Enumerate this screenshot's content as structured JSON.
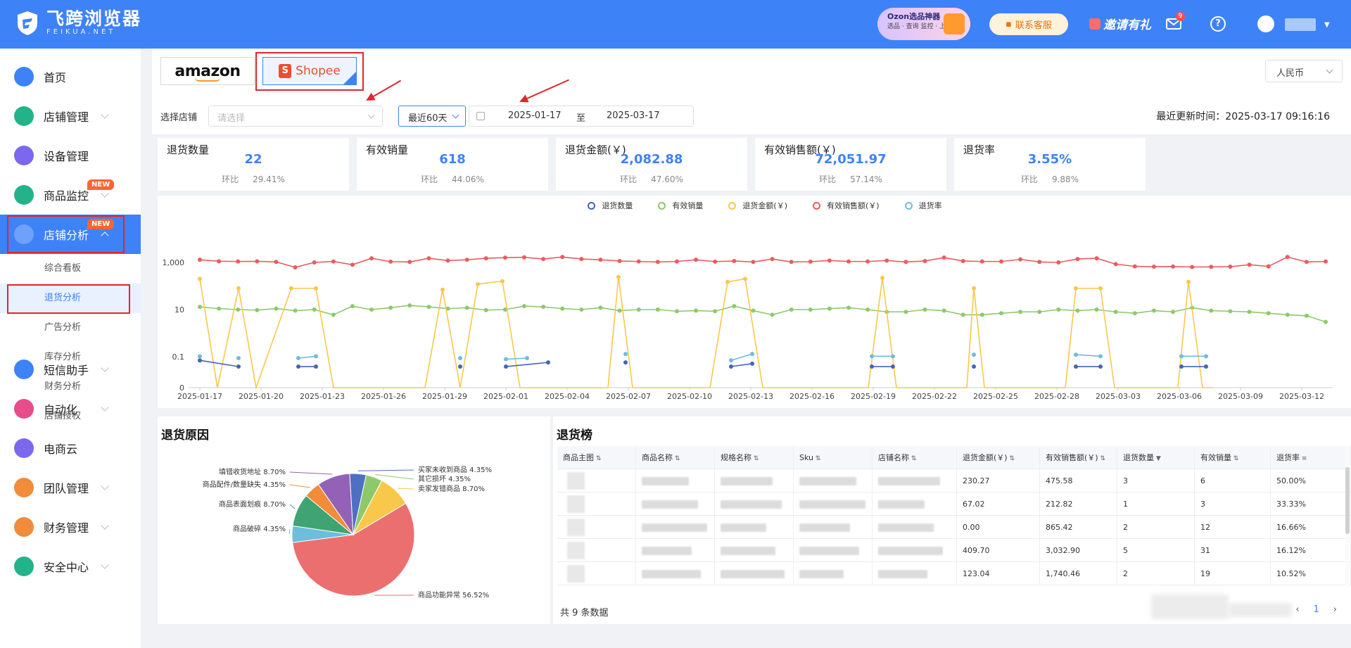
{
  "header": {
    "logo_cn": "飞跨浏览器",
    "logo_en": "FEIKUA.NET",
    "ozon_title": "Ozon选品神器",
    "ozon_sub": "选品 · 查询 监控 · 上货",
    "service": "联系客服",
    "invite": "邀请有礼",
    "mail_count": "9",
    "help": "?"
  },
  "sidebar": {
    "items": [
      {
        "label": "首页",
        "icon": "home-icon",
        "color": "#3e82f7"
      },
      {
        "label": "店铺管理",
        "icon": "store-icon",
        "color": "#22b38a"
      },
      {
        "label": "设备管理",
        "icon": "device-icon",
        "color": "#7b68ee"
      },
      {
        "label": "商品监控",
        "icon": "monitor-icon",
        "color": "#22b38a",
        "badge": "NEW"
      },
      {
        "label": "店铺分析",
        "icon": "analysis-icon",
        "color": "#ffffff",
        "badge": "NEW"
      },
      {
        "label": "短信助手",
        "icon": "sms-icon",
        "color": "#3e82f7"
      },
      {
        "label": "自动化",
        "icon": "robot-icon",
        "color": "#e84c8a"
      },
      {
        "label": "电商云",
        "icon": "cloud-icon",
        "color": "#7b68ee"
      },
      {
        "label": "团队管理",
        "icon": "team-icon",
        "color": "#f08c3a"
      },
      {
        "label": "财务管理",
        "icon": "wallet-icon",
        "color": "#f08c3a"
      },
      {
        "label": "安全中心",
        "icon": "shield-icon",
        "color": "#22b38a"
      }
    ],
    "subitems": [
      "综合看板",
      "退货分析",
      "广告分析",
      "库存分析",
      "财务分析",
      "店铺授权"
    ]
  },
  "platforms": {
    "amazon": "amazon",
    "shopee": "Shopee"
  },
  "currency": "人民币",
  "filters": {
    "shop_label": "选择店铺",
    "shop_placeholder": "请选择",
    "range": "最近60天",
    "start": "2025-01-17",
    "to": "至",
    "end": "2025-03-17",
    "updated": "最近更新时间：2025-03-17 09:16:16"
  },
  "kpis": [
    {
      "title": "退货数量",
      "value": "22",
      "cmp_label": "环比",
      "cmp": "29.41%"
    },
    {
      "title": "有效销量",
      "value": "618",
      "cmp_label": "环比",
      "cmp": "44.06%"
    },
    {
      "title": "退货金额(￥)",
      "value": "2,082.88",
      "cmp_label": "环比",
      "cmp": "47.60%"
    },
    {
      "title": "有效销售额(￥)",
      "value": "72,051.97",
      "cmp_label": "环比",
      "cmp": "57.14%"
    },
    {
      "title": "退货率",
      "value": "3.55%",
      "cmp_label": "环比",
      "cmp": "9.88%"
    }
  ],
  "chart_data": [
    {
      "type": "line",
      "log_y": true,
      "grid": false,
      "legend": "top-center",
      "y_ticks": [
        "1,000",
        "10",
        "0.1",
        "0"
      ],
      "x_ticks": [
        "2025-01-17",
        "2025-01-20",
        "2025-01-23",
        "2025-01-26",
        "2025-01-29",
        "2025-02-01",
        "2025-02-04",
        "2025-02-07",
        "2025-02-10",
        "2025-02-13",
        "2025-02-16",
        "2025-02-19",
        "2025-02-22",
        "2025-02-25",
        "2025-02-28",
        "2025-03-03",
        "2025-03-06",
        "2025-03-09",
        "2025-03-12"
      ],
      "series": [
        {
          "name": "退货数量",
          "color": "#4563b9"
        },
        {
          "name": "有效销量",
          "color": "#8dc96b"
        },
        {
          "name": "退货金额(￥)",
          "color": "#f9c84a"
        },
        {
          "name": "有效销售额(￥)",
          "color": "#ec5b5f"
        },
        {
          "name": "退货率",
          "color": "#6dbddb"
        }
      ],
      "values": {
        "有效销售额(￥)": [
          1300,
          1120,
          1100,
          1110,
          1050,
          620,
          1000,
          1100,
          800,
          1500,
          1080,
          1050,
          1500,
          1200,
          1300,
          1500,
          1600,
          1650,
          1400,
          1700,
          1400,
          1300,
          1150,
          1100,
          1050,
          1100,
          1300,
          1080,
          1150,
          1050,
          1400,
          1050,
          1080,
          1200,
          1100,
          1100,
          1200,
          1050,
          1150,
          1600,
          1150,
          1100,
          1100,
          1350,
          1050,
          1000,
          1400,
          1500,
          850,
          680,
          660,
          670,
          640,
          650,
          660,
          800,
          680,
          1700,
          1050,
          1100,
          1100,
          1200,
          1300,
          1550,
          1600,
          1350,
          1000,
          1250,
          1200,
          1050,
          1600,
          1200,
          1150,
          1050,
          1400,
          1500,
          1080,
          900,
          660,
          620,
          300,
          400,
          1000,
          220,
          1600,
          700
        ],
        "有效销量": [
          13,
          11,
          10,
          9.5,
          11,
          9,
          10,
          6,
          14,
          10,
          12,
          15,
          13,
          11,
          12,
          9.5,
          10,
          14,
          13,
          11,
          10,
          12,
          9,
          10,
          10,
          8.5,
          9,
          8.5,
          14,
          9,
          6,
          10,
          10,
          11,
          12,
          10,
          8,
          8,
          10,
          9,
          6,
          6,
          7,
          8,
          8,
          10,
          9,
          10,
          8,
          7,
          9,
          8,
          12,
          9,
          8.5,
          8,
          7,
          6,
          5.5,
          3,
          8,
          4,
          10,
          7
        ],
        "退货金额(￥)": [
          2.1,
          0,
          0,
          0.9,
          0,
          0,
          0.5,
          1.2,
          0.7,
          1.2,
          0,
          0,
          0,
          0.9,
          0,
          0,
          0,
          0,
          0,
          0,
          0,
          0,
          0.8,
          0,
          0.5,
          0,
          0
        ],
        "退货数量": [
          0.6,
          0.9,
          0.9,
          0.9,
          0.9,
          0.8,
          1.1,
          0.6,
          1.0,
          0.9,
          0.8,
          0.9,
          0.9
        ],
        "退货率": [
          0.15,
          0.12,
          0.11,
          0.13,
          0.12,
          0.14,
          0.12,
          0.18,
          0.2,
          0.14,
          0.12,
          0.12,
          0.12,
          0.13,
          0.14,
          0.13,
          0.12
        ]
      }
    },
    {
      "type": "pie",
      "title": "退货原因",
      "slices": [
        {
          "label": "商品功能异常 56.52%",
          "value": 56.52,
          "color": "#ec6f70"
        },
        {
          "label": "商品破碎 4.35%",
          "value": 4.35,
          "color": "#6dbddb"
        },
        {
          "label": "商品表面划痕 8.70%",
          "value": 8.7,
          "color": "#3fa472"
        },
        {
          "label": "商品配件/数量缺失 4.35%",
          "value": 4.35,
          "color": "#f08c3a"
        },
        {
          "label": "填错收货地址 8.70%",
          "value": 8.7,
          "color": "#9362b6"
        },
        {
          "label": "买家未收到商品 4.35%",
          "value": 4.35,
          "color": "#4f6fc2"
        },
        {
          "label": "其它损坏 4.35%",
          "value": 4.35,
          "color": "#8dc96b"
        },
        {
          "label": "卖家发错商品 8.70%",
          "value": 8.7,
          "color": "#f9c84a"
        }
      ]
    }
  ],
  "rank": {
    "title": "退货榜",
    "columns": [
      "商品主图",
      "商品名称",
      "规格名称",
      "Sku",
      "店铺名称",
      "退货金额(￥)",
      "有效销售额(￥)",
      "退货数量",
      "有效销量",
      "退货率"
    ],
    "rows": [
      [
        "230.27",
        "475.58",
        "3",
        "6",
        "50.00%"
      ],
      [
        "67.02",
        "212.82",
        "1",
        "3",
        "33.33%"
      ],
      [
        "0.00",
        "865.42",
        "2",
        "12",
        "16.66%"
      ],
      [
        "409.70",
        "3,032.90",
        "5",
        "31",
        "16.12%"
      ],
      [
        "123.04",
        "1,740.46",
        "2",
        "19",
        "10.52%"
      ]
    ],
    "total": "共 9 条数据",
    "page": "1",
    "prev": "‹",
    "next": "›"
  }
}
